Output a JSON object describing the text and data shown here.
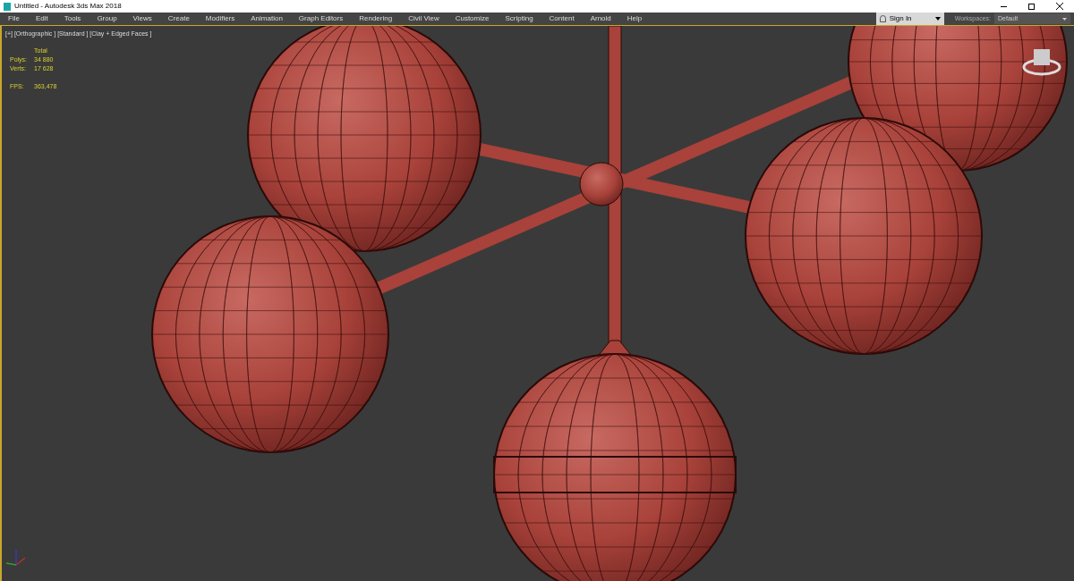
{
  "window": {
    "title": "Untitled - Autodesk 3ds Max 2018"
  },
  "menu": [
    "File",
    "Edit",
    "Tools",
    "Group",
    "Views",
    "Create",
    "Modifiers",
    "Animation",
    "Graph Editors",
    "Rendering",
    "Civil View",
    "Customize",
    "Scripting",
    "Content",
    "Arnold",
    "Help"
  ],
  "sign_in": {
    "label": "Sign In"
  },
  "workspaces": {
    "label": "Workspaces:",
    "value": "Default"
  },
  "viewport": {
    "label": "[+] [Orthographic ] [Standard ] [Clay + Edged Faces ]",
    "stats": {
      "header": "Total",
      "rows": [
        {
          "label": "Polys:",
          "value": "34 880"
        },
        {
          "label": "Verts:",
          "value": "17 628"
        }
      ],
      "fps": {
        "label": "FPS:",
        "value": "363,478"
      }
    }
  }
}
